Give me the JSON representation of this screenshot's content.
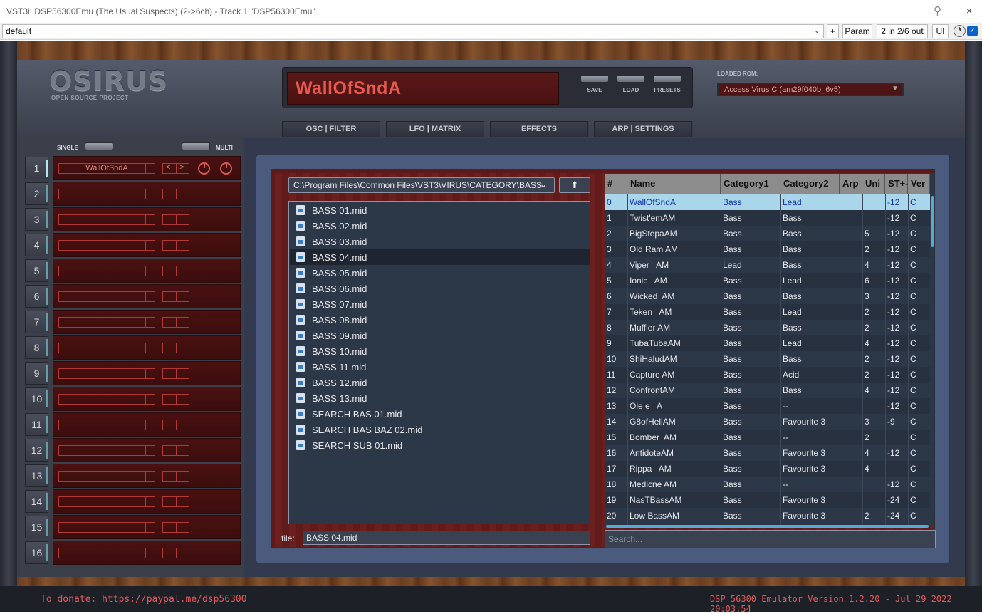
{
  "window": {
    "title": "VST3i: DSP56300Emu (The Usual Suspects) (2->6ch) - Track 1 \"DSP56300Emu\"",
    "close_glyph": "×",
    "pin_glyph": "⚲"
  },
  "host": {
    "preset": "default",
    "add_label": "+",
    "param_label": "Param",
    "io_label": "2 in 2/6 out",
    "ui_label": "UI"
  },
  "header": {
    "logo": "OSIRUS",
    "logo_sub": "OPEN SOURCE PROJECT",
    "patch_name": "WallOfSndA",
    "save_label": "SAVE",
    "load_label": "LOAD",
    "presets_label": "PRESETS",
    "rom_label": "LOADED ROM:",
    "rom_value": "Access Virus C (am29f040b_6v5)"
  },
  "tabs": [
    "OSC | FILTER",
    "LFO | MATRIX",
    "EFFECTS",
    "ARP | SETTINGS"
  ],
  "parts": {
    "single_label": "SINGLE",
    "multi_label": "MULTI",
    "numbers": [
      "1",
      "2",
      "3",
      "4",
      "5",
      "6",
      "7",
      "8",
      "9",
      "10",
      "11",
      "12",
      "13",
      "14",
      "15",
      "16"
    ],
    "part1_name": "WallOfSndA",
    "arrow_prev": "<",
    "arrow_next": ">"
  },
  "browser": {
    "path": "C:\\Program Files\\Common Files\\VST3\\VIRUS\\CATEGORY\\BASS",
    "up_glyph": "⬆",
    "files": [
      "BASS 01.mid",
      "BASS 02.mid",
      "BASS 03.mid",
      "BASS 04.mid",
      "BASS 05.mid",
      "BASS 06.mid",
      "BASS 07.mid",
      "BASS 08.mid",
      "BASS 09.mid",
      "BASS 10.mid",
      "BASS 11.mid",
      "BASS 12.mid",
      "BASS 13.mid",
      "SEARCH BAS 01.mid",
      "SEARCH BAS BAZ 02.mid",
      "SEARCH SUB 01.mid"
    ],
    "selected_file": "BASS 04.mid",
    "file_label": "file:",
    "file_value": "BASS 04.mid",
    "search_placeholder": "Search..."
  },
  "table": {
    "headers": [
      "#",
      "Name",
      "Category1",
      "Category2",
      "Arp",
      "Uni",
      "ST+-",
      "Ver"
    ],
    "rows": [
      [
        "0",
        "WallOfSndA",
        "Bass",
        "Lead",
        "",
        "",
        "-12",
        "C"
      ],
      [
        "1",
        "Twist'emAM",
        "Bass",
        "Bass",
        "",
        "",
        "-12",
        "C"
      ],
      [
        "2",
        "BigStepaAM",
        "Bass",
        "Bass",
        "",
        "5",
        "-12",
        "C"
      ],
      [
        "3",
        "Old Ram AM",
        "Bass",
        "Bass",
        "",
        "2",
        "-12",
        "C"
      ],
      [
        "4",
        "Viper   AM",
        "Lead",
        "Bass",
        "",
        "4",
        "-12",
        "C"
      ],
      [
        "5",
        "Ionic   AM",
        "Bass",
        "Lead",
        "",
        "6",
        "-12",
        "C"
      ],
      [
        "6",
        "Wicked  AM",
        "Bass",
        "Bass",
        "",
        "3",
        "-12",
        "C"
      ],
      [
        "7",
        "Teken   AM",
        "Bass",
        "Lead",
        "",
        "2",
        "-12",
        "C"
      ],
      [
        "8",
        "Muffler AM",
        "Bass",
        "Bass",
        "",
        "2",
        "-12",
        "C"
      ],
      [
        "9",
        "TubaTubaAM",
        "Bass",
        "Lead",
        "",
        "4",
        "-12",
        "C"
      ],
      [
        "10",
        "ShiHaludAM",
        "Bass",
        "Bass",
        "",
        "2",
        "-12",
        "C"
      ],
      [
        "11",
        "Capture AM",
        "Bass",
        "Acid",
        "",
        "2",
        "-12",
        "C"
      ],
      [
        "12",
        "ConfrontAM",
        "Bass",
        "Bass",
        "",
        "4",
        "-12",
        "C"
      ],
      [
        "13",
        "Ole e   A",
        "Bass",
        "--",
        "",
        "",
        "-12",
        "C"
      ],
      [
        "14",
        "G8ofHellAM",
        "Bass",
        "Favourite 3",
        "",
        "3",
        "-9",
        "C"
      ],
      [
        "15",
        "Bomber  AM",
        "Bass",
        "--",
        "",
        "2",
        "",
        "C"
      ],
      [
        "16",
        "AntidoteAM",
        "Bass",
        "Favourite 3",
        "",
        "4",
        "-12",
        "C"
      ],
      [
        "17",
        "Rippa   AM",
        "Bass",
        "Favourite 3",
        "",
        "4",
        "",
        "C"
      ],
      [
        "18",
        "Medicne AM",
        "Bass",
        "--",
        "",
        "",
        "-12",
        "C"
      ],
      [
        "19",
        "NasTBassAM",
        "Bass",
        "Favourite 3",
        "",
        "",
        "-24",
        "C"
      ],
      [
        "20",
        "Low BassAM",
        "Bass",
        "Favourite 3",
        "",
        "2",
        "-24",
        "C"
      ]
    ]
  },
  "footer": {
    "donate": "To donate: https://paypal.me/dsp56300",
    "version": "DSP 56300 Emulator Version 1.2.20 - Jul 29 2022 20:03:54"
  }
}
